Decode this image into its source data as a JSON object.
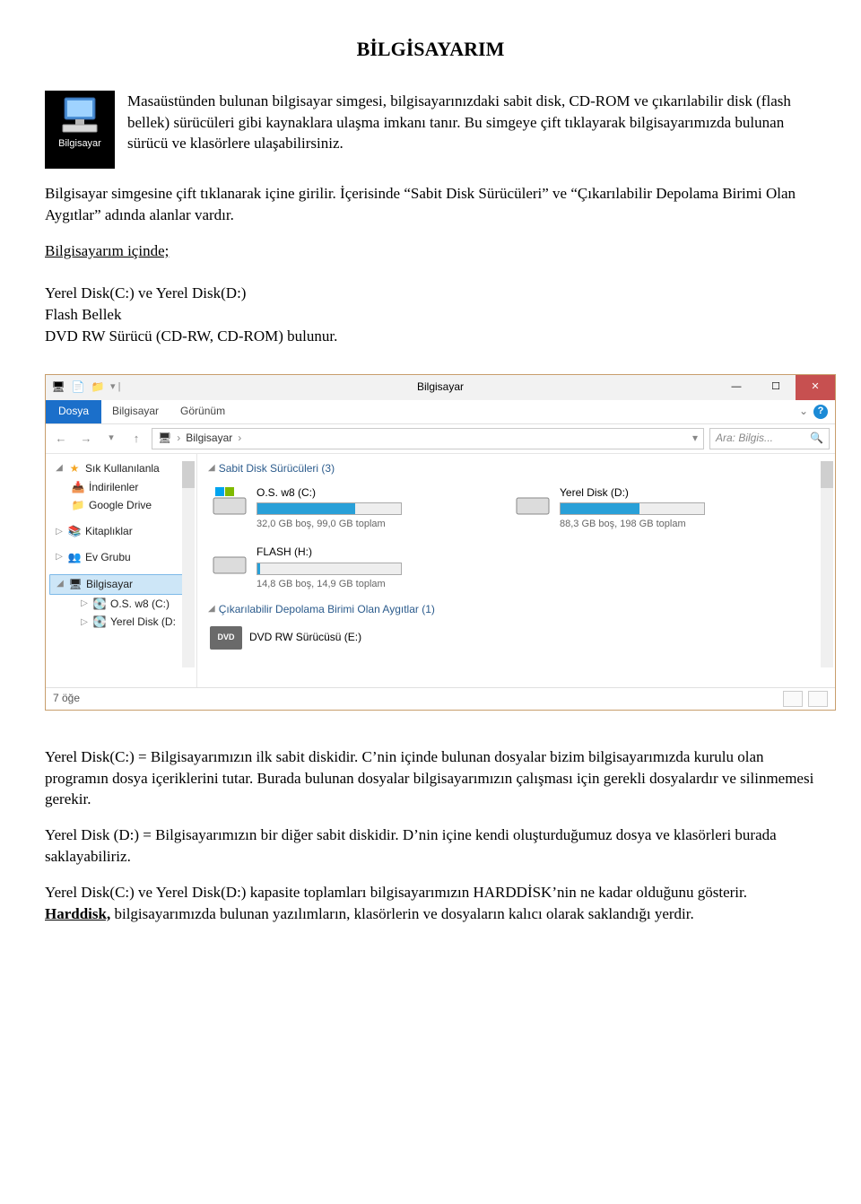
{
  "title": "BİLGİSAYARIM",
  "desktop_icon_label": "Bilgisayar",
  "para": {
    "intro": "Masaüstünden bulunan bilgisayar simgesi, bilgisayarınızdaki sabit disk, CD-ROM ve çıkarılabilir disk (flash bellek) sürücüleri gibi kaynaklara ulaşma imkanı tanır. Bu simgeye çift tıklayarak bilgisayarımızda bulunan sürücü ve klasörlere ulaşabilirsiniz.",
    "p2": "Bilgisayar simgesine çift tıklanarak içine girilir. İçerisinde “Sabit Disk Sürücüleri” ve “Çıkarılabilir Depolama Birimi Olan Aygıtlar” adında alanlar vardır.",
    "p3_label": "Bilgisayarım içinde;",
    "list1": "Yerel Disk(C:) ve Yerel Disk(D:)",
    "list2": "Flash Bellek",
    "list3": "DVD RW Sürücü (CD-RW, CD-ROM) bulunur.",
    "after1": "Yerel Disk(C:) = Bilgisayarımızın ilk sabit diskidir. C’nin içinde bulunan dosyalar bizim bilgisayarımızda kurulu olan programın dosya içeriklerini tutar. Burada bulunan dosyalar bilgisayarımızın çalışması için gerekli dosyalardır ve silinmemesi gerekir.",
    "after2": "Yerel Disk (D:) = Bilgisayarımızın bir diğer sabit diskidir. D’nin içine kendi oluşturduğumuz dosya ve klasörleri burada saklayabiliriz.",
    "after3a": "Yerel Disk(C:) ve Yerel Disk(D:) kapasite toplamları bilgisayarımızın HARDDİSK’nin ne kadar olduğunu gösterir. ",
    "harddisk": "Harddisk,",
    "after3b": " bilgisayarımızda bulunan yazılımların, klasörlerin ve dosyaların kalıcı olarak saklandığı yerdir."
  },
  "explorer": {
    "title": "Bilgisayar",
    "tabs": {
      "file": "Dosya",
      "computer": "Bilgisayar",
      "view": "Görünüm"
    },
    "breadcrumb": {
      "computer": "Bilgisayar"
    },
    "search_placeholder": "Ara: Bilgis...",
    "tree": {
      "favorites": "Sık Kullanılanla",
      "downloads": "İndirilenler",
      "gdrive": "Google Drive",
      "libraries": "Kitaplıklar",
      "homegroup": "Ev Grubu",
      "computer": "Bilgisayar",
      "osw8": "O.S. w8 (C:)",
      "yereld": "Yerel Disk (D:"
    },
    "sections": {
      "hdd_header": "Sabit Disk Sürücüleri (3)",
      "removable_header": "Çıkarılabilir Depolama Birimi Olan Aygıtlar (1)"
    },
    "drives": {
      "c": {
        "name": "O.S. w8 (C:)",
        "sub": "32,0 GB boş, 99,0 GB toplam",
        "fill": "68%"
      },
      "d": {
        "name": "Yerel Disk (D:)",
        "sub": "88,3 GB boş, 198 GB toplam",
        "fill": "55%"
      },
      "h": {
        "name": "FLASH (H:)",
        "sub": "14,8 GB boş, 14,9 GB toplam",
        "fill": "2%"
      },
      "dvd": {
        "name": "DVD RW Sürücüsü (E:)"
      }
    },
    "status": "7 öğe"
  }
}
